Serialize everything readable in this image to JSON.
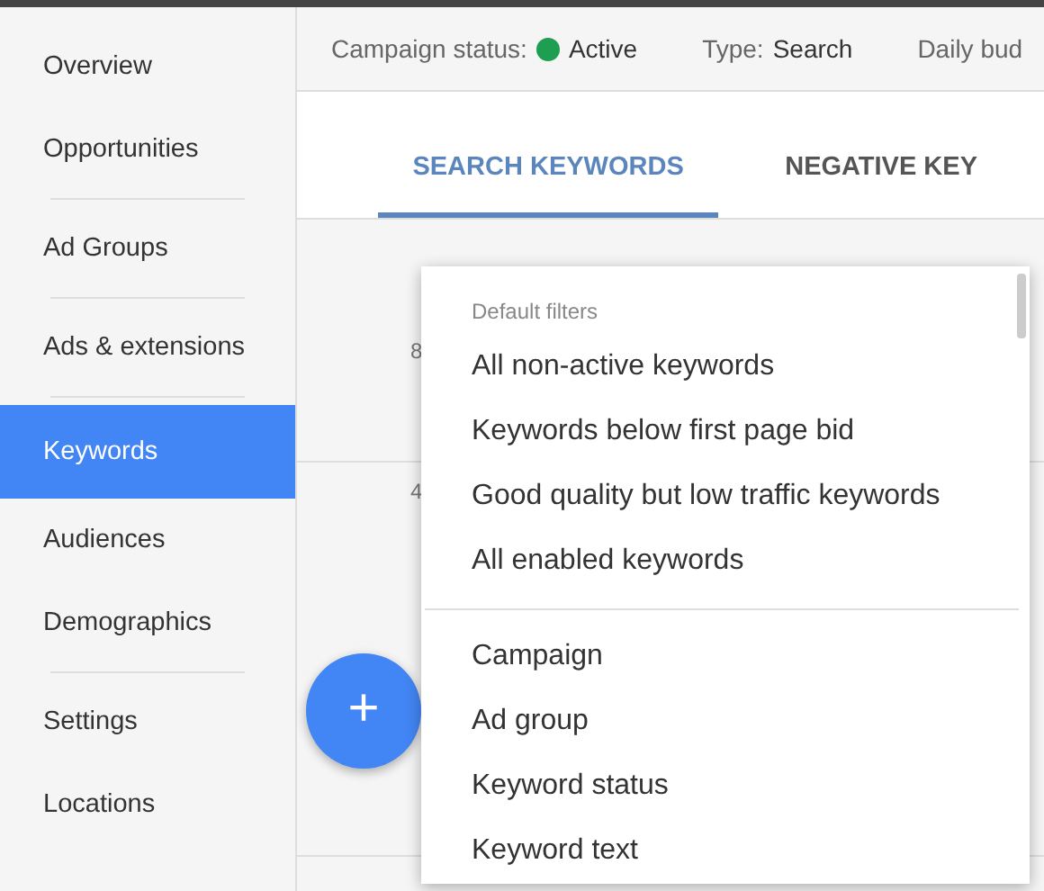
{
  "sidebar": {
    "groups": [
      {
        "items": [
          {
            "label": "Overview",
            "selected": false
          },
          {
            "label": "Opportunities",
            "selected": false
          }
        ]
      },
      {
        "items": [
          {
            "label": "Ad Groups",
            "selected": false
          }
        ]
      },
      {
        "items": [
          {
            "label": "Ads & extensions",
            "selected": false
          }
        ]
      },
      {
        "items": [
          {
            "label": "Keywords",
            "selected": true
          },
          {
            "label": "Audiences",
            "selected": false
          },
          {
            "label": "Demographics",
            "selected": false
          }
        ]
      },
      {
        "items": [
          {
            "label": "Settings",
            "selected": false
          },
          {
            "label": "Locations",
            "selected": false
          }
        ]
      }
    ]
  },
  "status_bar": {
    "status_label": "Campaign status:",
    "status_value": "Active",
    "type_label": "Type:",
    "type_value": "Search",
    "budget_label": "Daily bud"
  },
  "tabs": [
    {
      "label": "SEARCH KEYWORDS",
      "selected": true
    },
    {
      "label": "NEGATIVE KEY",
      "selected": false
    }
  ],
  "chart_axis_labels": [
    "8",
    "4"
  ],
  "add_button": {
    "label": "+"
  },
  "filter_menu": {
    "sections": [
      {
        "heading": "Default filters",
        "items": [
          "All non-active keywords",
          "Keywords below first page bid",
          "Good quality but low traffic keywords",
          "All enabled keywords"
        ]
      },
      {
        "items": [
          "Campaign",
          "Ad group",
          "Keyword status",
          "Keyword text"
        ]
      }
    ]
  }
}
